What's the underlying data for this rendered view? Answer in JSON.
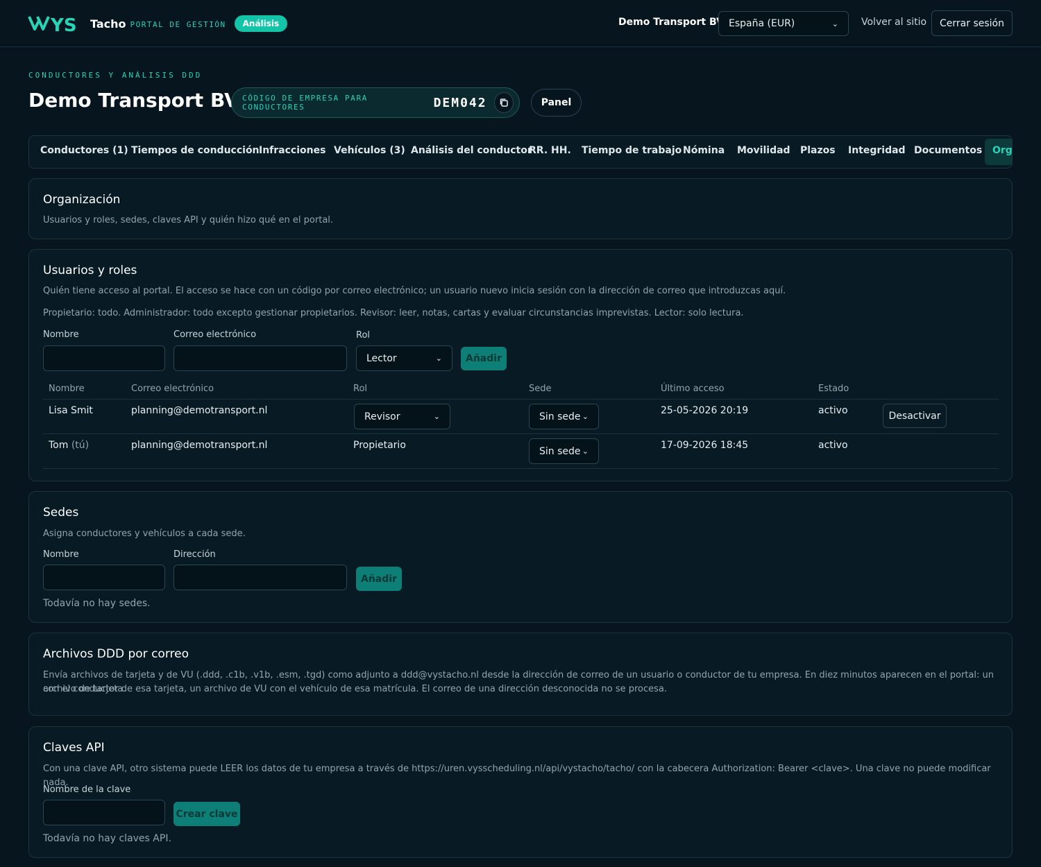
{
  "topbar": {
    "brand_logo": "VYS",
    "brand_name": "Tacho",
    "brand_sub": "PORTAL DE GESTIÓN",
    "analysis_pill": "Análisis",
    "company": "Demo Transport BV",
    "region_select": "España (EUR)",
    "back_link": "Volver al sitio",
    "logout": "Cerrar sesión"
  },
  "header": {
    "eyebrow": "CONDUCTORES Y ANÁLISIS DDD",
    "title": "Demo Transport BV",
    "code_label": "CÓDIGO DE EMPRESA PARA CONDUCTORES",
    "code_value": "DEM042",
    "panel_button": "Panel"
  },
  "tabs": [
    "Conductores (1)",
    "Tiempos de conducción",
    "Infracciones",
    "Vehículos (3)",
    "Análisis del conductor",
    "RR. HH.",
    "Tiempo de trabajo",
    "Nómina",
    "Movilidad",
    "Plazos",
    "Integridad",
    "Documentos",
    "Orga"
  ],
  "organization": {
    "title": "Organización",
    "text": "Usuarios y roles, sedes, claves API y quién hizo qué en el portal."
  },
  "users": {
    "title": "Usuarios y roles",
    "text1": "Quién tiene acceso al portal. El acceso se hace con un código por correo electrónico; un usuario nuevo inicia sesión con la dirección de correo que introduzcas aquí.",
    "text2": "Propietario: todo. Administrador: todo excepto gestionar propietarios. Revisor: leer, notas, cartas y evaluar circunstancias imprevistas. Lector: solo lectura.",
    "form": {
      "name_label": "Nombre",
      "email_label": "Correo electrónico",
      "role_label": "Rol",
      "role_value": "Lector",
      "add_button": "Añadir"
    },
    "columns": [
      "Nombre",
      "Correo electrónico",
      "Rol",
      "Sede",
      "Último acceso",
      "Estado"
    ],
    "rows": [
      {
        "name": "Lisa Smit",
        "email": "planning@demotransport.nl",
        "role": "Revisor",
        "site": "Sin sede",
        "last_access": "25-05-2026 20:19",
        "status": "activo",
        "action": "Desactivar"
      },
      {
        "name": "Tom",
        "name_suffix": "(tú)",
        "email": "planning@demotransport.nl",
        "role": "Propietario",
        "site": "Sin sede",
        "last_access": "17-09-2026 18:45",
        "status": "activo"
      }
    ]
  },
  "sites": {
    "title": "Sedes",
    "text": "Asigna conductores y vehículos a cada sede.",
    "name_label": "Nombre",
    "address_label": "Dirección",
    "add_button": "Añadir",
    "empty": "Todavía no hay sedes."
  },
  "ddd_mail": {
    "title": "Archivos DDD por correo",
    "text1": "Envía archivos de tarjeta y de VU (.ddd, .c1b, .v1b, .esm, .tgd) como adjunto a ddd@vystacho.nl desde la dirección de correo de un usuario o conductor de tu empresa. En diez minutos aparecen en el portal: un archivo de tarjeta",
    "text2": "con el conductor de esa tarjeta, un archivo de VU con el vehículo de esa matrícula. El correo de una dirección desconocida no se procesa."
  },
  "api_keys": {
    "title": "Claves API",
    "text": "Con una clave API, otro sistema puede LEER los datos de tu empresa a través de https://uren.vysscheduling.nl/api/vystacho/tacho/ con la cabecera Authorization: Bearer <clave>. Una clave no puede modificar nada.",
    "name_label": "Nombre de la clave",
    "create_button": "Crear clave",
    "empty": "Todavía no hay claves API."
  },
  "icons": {
    "copy": "copy-icon",
    "chevron": "chevron-down-icon",
    "logo": "vys-logo"
  },
  "colors": {
    "accent": "#28d3b8",
    "background": "#06151e",
    "card": "#081b24",
    "button_teal": "#0e7f77"
  }
}
